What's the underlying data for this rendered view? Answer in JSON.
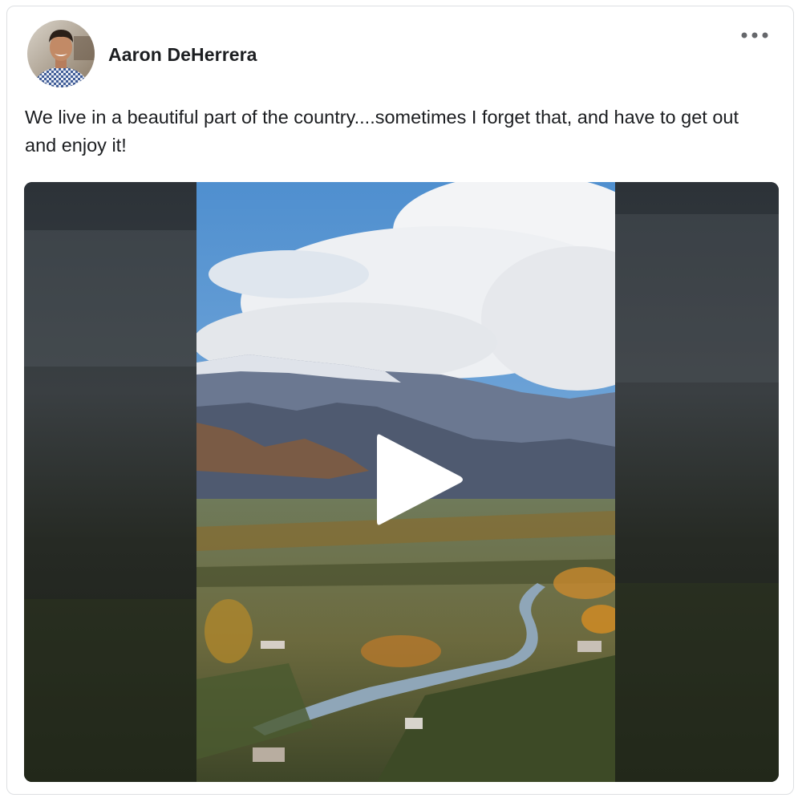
{
  "post": {
    "author_name": "Aaron DeHerrera",
    "text": "We live in a beautiful part of the country....sometimes I forget that, and have to get out and enjoy it!",
    "more_icon": "more-horizontal-icon",
    "video": {
      "play_icon": "play-icon",
      "orientation": "portrait"
    }
  },
  "colors": {
    "text": "#1c1e21",
    "border": "#dddfe2",
    "more_dots": "#65676b",
    "sky": "#5c9ad2",
    "cloud": "#f1f2f4",
    "mountain": "#5d6b86",
    "river": "#8fa6b8",
    "foliage_autumn": "#c98a2e",
    "orchard": "#3d4a26"
  }
}
